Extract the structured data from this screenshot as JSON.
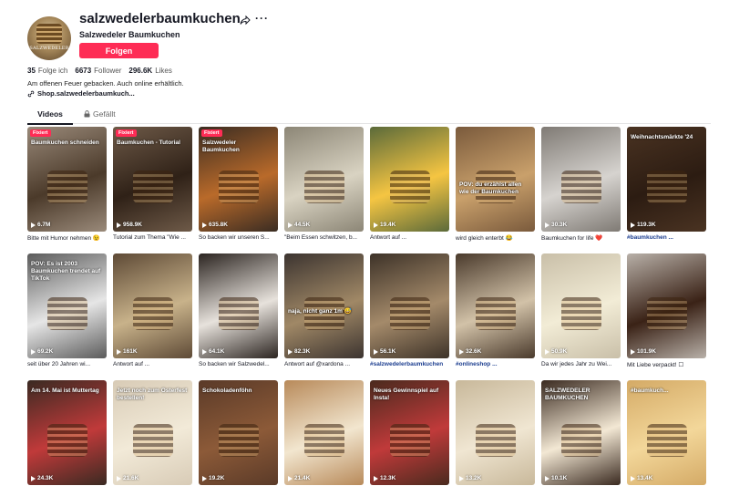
{
  "profile": {
    "username": "salzwedelerbaumkuchen",
    "display_name": "Salzwedeler Baumkuchen",
    "follow_label": "Folgen",
    "avatar_text": "SALZWEDELER",
    "stats": {
      "following_count": "35",
      "following_label": "Folge ich",
      "followers_count": "6673",
      "followers_label": "Follower",
      "likes_count": "296.6K",
      "likes_label": "Likes"
    },
    "bio": "Am offenen Feuer gebacken. Auch online erhältlich.",
    "link": "Shop.salzwedelerbaumkuch..."
  },
  "tabs": {
    "videos": "Videos",
    "liked": "Gefällt"
  },
  "videos": [
    {
      "views": "6.7M",
      "caption": "Bitte mit Humor nehmen 😉",
      "pinned": "Fixiert",
      "overlay": "Baumkuchen schneiden",
      "bg": "#9a8a7a",
      "accent": "#4b3a2a"
    },
    {
      "views": "958.9K",
      "caption": "Tutorial zum Thema \"Wie ...",
      "pinned": "Fixiert",
      "overlay": "Baumkuchen - Tutorial",
      "bg": "#6e5a48",
      "accent": "#2f2117"
    },
    {
      "views": "635.8K",
      "caption": "So backen wir unseren S...",
      "pinned": "Fixiert",
      "overlay": "Salzwedeler Baumkuchen",
      "bg": "#3a2c22",
      "accent": "#b96a2a"
    },
    {
      "views": "44.5K",
      "caption": "\"Beim Essen schwitzen, b...",
      "overlay": "",
      "bg": "#8c8676",
      "accent": "#d9d3c2"
    },
    {
      "views": "19.4K",
      "caption": "Antwort auf ...",
      "overlay": "",
      "bg": "#5b6a3a",
      "accent": "#f5c542"
    },
    {
      "views": "",
      "caption": "wird gleich enterbt 😂",
      "overlay": "POV: du erzählst allen wie der Baumkuchen",
      "bg": "#7a5a3c",
      "accent": "#c9a06b"
    },
    {
      "views": "30.3K",
      "caption": "Baumkuchen for life ❤️",
      "overlay": "",
      "bg": "#7f7a74",
      "accent": "#d6d3cf"
    },
    {
      "views": "119.3K",
      "caption": "#baumkuchen ...",
      "caption_is_tag": true,
      "overlay": "Weihnachtsmärkte '24",
      "bg": "#4a3322",
      "accent": "#2c1c12"
    },
    {
      "views": "69.2K",
      "caption": "seit über 20 Jahren wi...",
      "overlay": "POV: Es ist 2003 Baumkuchen trendet auf TikTok",
      "bg": "#5b5b5b",
      "accent": "#e6e6e6"
    },
    {
      "views": "161K",
      "caption": "Antwort auf ...",
      "overlay": "",
      "bg": "#5e4a36",
      "accent": "#c8b28a"
    },
    {
      "views": "64.1K",
      "caption": "So backen wir Salzwedel...",
      "overlay": "",
      "bg": "#2b2420",
      "accent": "#e7e2dc"
    },
    {
      "views": "82.3K",
      "caption": "Antwort auf @xardona ...",
      "overlay": "naja, nicht ganz 1m 😅",
      "bg": "#3c3430",
      "accent": "#a08866"
    },
    {
      "views": "56.1K",
      "caption": "#salzwedelerbaumkuchen",
      "caption_is_tag": true,
      "overlay": "",
      "bg": "#3d3228",
      "accent": "#a48a6a"
    },
    {
      "views": "32.6K",
      "caption": "#onlineshop ...",
      "caption_is_tag": true,
      "overlay": "",
      "bg": "#4a3a2c",
      "accent": "#d2c2a8"
    },
    {
      "views": "50.9K",
      "caption": "Da wir jedes Jahr zu Wei...",
      "overlay": "",
      "bg": "#c9bfa8",
      "accent": "#f2ecd6"
    },
    {
      "views": "101.9K",
      "caption": "Mit Liebe verpackt! ☐",
      "overlay": "",
      "bg": "#b8b0a8",
      "accent": "#3a2216"
    },
    {
      "views": "24.3K",
      "caption": "",
      "overlay": "Am 14. Mai ist Muttertag",
      "bg": "#3a2a22",
      "accent": "#c03a3a"
    },
    {
      "views": "21.6K",
      "caption": "",
      "overlay": "Jetzt noch zum Osterfest bestellen!",
      "bg": "#d8cbb6",
      "accent": "#f2ead8"
    },
    {
      "views": "19.2K",
      "caption": "",
      "overlay": "Schokoladenföhn",
      "bg": "#5a3a28",
      "accent": "#8c5a38"
    },
    {
      "views": "21.4K",
      "caption": "",
      "overlay": "",
      "bg": "#b88a5a",
      "accent": "#f2e6cf"
    },
    {
      "views": "12.3K",
      "caption": "",
      "overlay": "Neues Gewinnspiel auf Insta!",
      "bg": "#4a2a1e",
      "accent": "#c03a3a"
    },
    {
      "views": "13.2K",
      "caption": "",
      "overlay": "",
      "bg": "#c8b89a",
      "accent": "#f0e6d2"
    },
    {
      "views": "10.1K",
      "caption": "",
      "overlay": "SALZWEDELER BAUMKUCHEN",
      "bg": "#3a2a20",
      "accent": "#f3e8d4"
    },
    {
      "views": "13.4K",
      "caption": "",
      "overlay": "#baumkuch...",
      "bg": "#d4aa66",
      "accent": "#f3d79a"
    }
  ],
  "colors": {
    "accent": "#fe2c55",
    "text": "#161823",
    "link_tag": "#1b3d8f"
  }
}
